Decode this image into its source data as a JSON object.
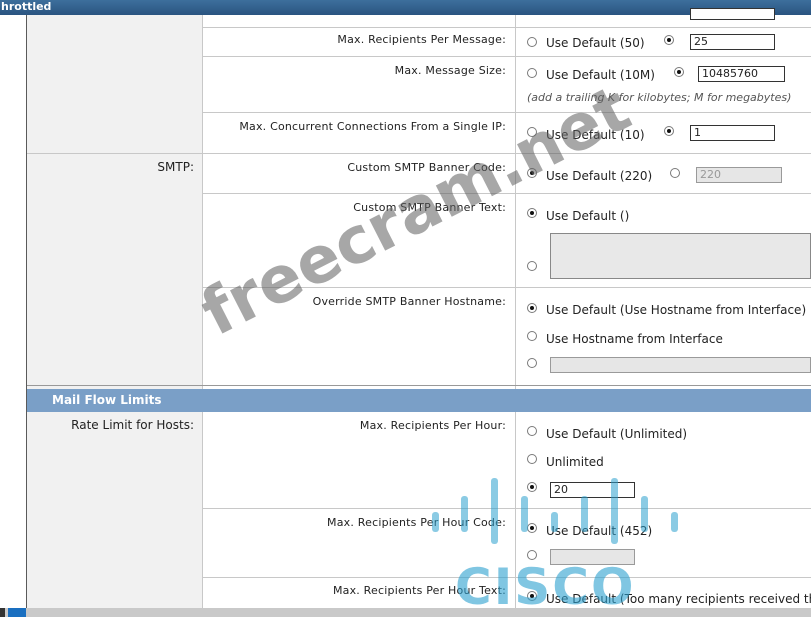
{
  "window": {
    "title": "hrottled"
  },
  "rows": {
    "max_recipients_per_message": {
      "label": "Max. Recipients Per Message:",
      "default_option": "Use Default (50)",
      "value": "25"
    },
    "max_message_size": {
      "label": "Max. Message Size:",
      "default_option": "Use Default (10M)",
      "value": "10485760",
      "hint": "(add a trailing K for kilobytes; M for megabytes)"
    },
    "max_concurrent_connections": {
      "label": "Max. Concurrent Connections From a Single IP:",
      "default_option": "Use Default (10)",
      "value": "1"
    },
    "smtp": {
      "group_label": "SMTP:",
      "banner_code": {
        "label": "Custom SMTP Banner Code:",
        "default_option": "Use Default (220)",
        "value": "220"
      },
      "banner_text": {
        "label": "Custom SMTP Banner Text:",
        "default_option": "Use Default ()"
      },
      "banner_hostname": {
        "label": "Override SMTP Banner Hostname:",
        "default_option": "Use Default (Use Hostname from Interface)",
        "option2": "Use Hostname from Interface"
      }
    }
  },
  "mail_flow_limits": {
    "section_title": "Mail Flow Limits",
    "group_label": "Rate Limit for Hosts:",
    "recipients_per_hour": {
      "label": "Max. Recipients Per Hour:",
      "default_option": "Use Default (Unlimited)",
      "option2": "Unlimited",
      "value": "20"
    },
    "recipients_per_hour_code": {
      "label": "Max. Recipients Per Hour Code:",
      "default_option": "Use Default (452)"
    },
    "recipients_per_hour_text": {
      "label": "Max. Recipients Per Hour Text:",
      "default_option": "Use Default (Too many recipients received this hour)"
    }
  },
  "overlays": {
    "watermark": "freecram.net",
    "logo": "CISCO"
  },
  "colors": {
    "section_header": "#7a9fc7",
    "title_bar": "#2a5480"
  }
}
